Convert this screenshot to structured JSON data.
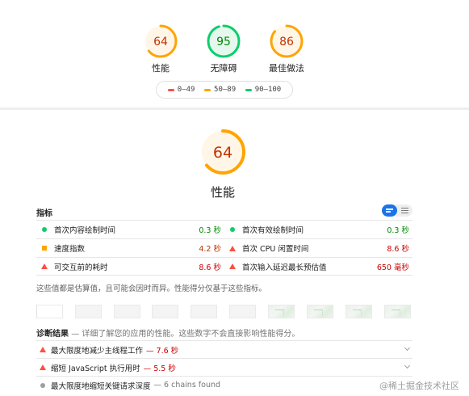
{
  "categories": [
    {
      "score": "64",
      "label": "性能",
      "color": "#ffa400",
      "bg": "#fff6e8",
      "text_color": "#c33300",
      "fraction": 0.64
    },
    {
      "score": "95",
      "label": "无障碍",
      "color": "#0cce6b",
      "bg": "#e6f8ee",
      "text_color": "#008800",
      "fraction": 0.95
    },
    {
      "score": "86",
      "label": "最佳做法",
      "color": "#ffa400",
      "bg": "#fff6e8",
      "text_color": "#c33300",
      "fraction": 0.86
    }
  ],
  "legend": [
    {
      "range": "0–49",
      "color": "#ff4e42"
    },
    {
      "range": "50–89",
      "color": "#ffa400"
    },
    {
      "range": "90–100",
      "color": "#0cce6b"
    }
  ],
  "main": {
    "score": "64",
    "fraction": 0.64,
    "title": "性能",
    "color": "#ffa400",
    "bg": "#fff6e8",
    "text_color": "#c33300"
  },
  "metrics": {
    "heading": "指标",
    "items": [
      {
        "name": "首次内容绘制时间",
        "value": "0.3 秒",
        "status": "pass"
      },
      {
        "name": "首次有效绘制时间",
        "value": "0.3 秒",
        "status": "pass"
      },
      {
        "name": "速度指数",
        "value": "4.2 秒",
        "status": "average"
      },
      {
        "name": "首次 CPU 闲置时间",
        "value": "8.6 秒",
        "status": "fail"
      },
      {
        "name": "可交互前的耗时",
        "value": "8.6 秒",
        "status": "fail"
      },
      {
        "name": "首次输入延迟最长预估值",
        "value": "650 毫秒",
        "status": "fail"
      }
    ],
    "note": "这些值都是估算值，且可能会因时而异。性能得分仅基于这些指标。"
  },
  "diagnostics": {
    "heading": "诊断结果",
    "subheading": "— 详细了解您的应用的性能。这些数字不会直接影响性能得分。",
    "items": [
      {
        "title": "最大限度地减少主线程工作",
        "display": "— 7.6 秒",
        "status": "fail"
      },
      {
        "title": "缩短 JavaScript 执行用时",
        "display": "— 5.5 秒",
        "status": "fail"
      },
      {
        "title": "最大限度地缩短关键请求深度",
        "display": "— 6 chains found",
        "status": "info"
      }
    ]
  },
  "watermark": "@稀土掘金技术社区"
}
